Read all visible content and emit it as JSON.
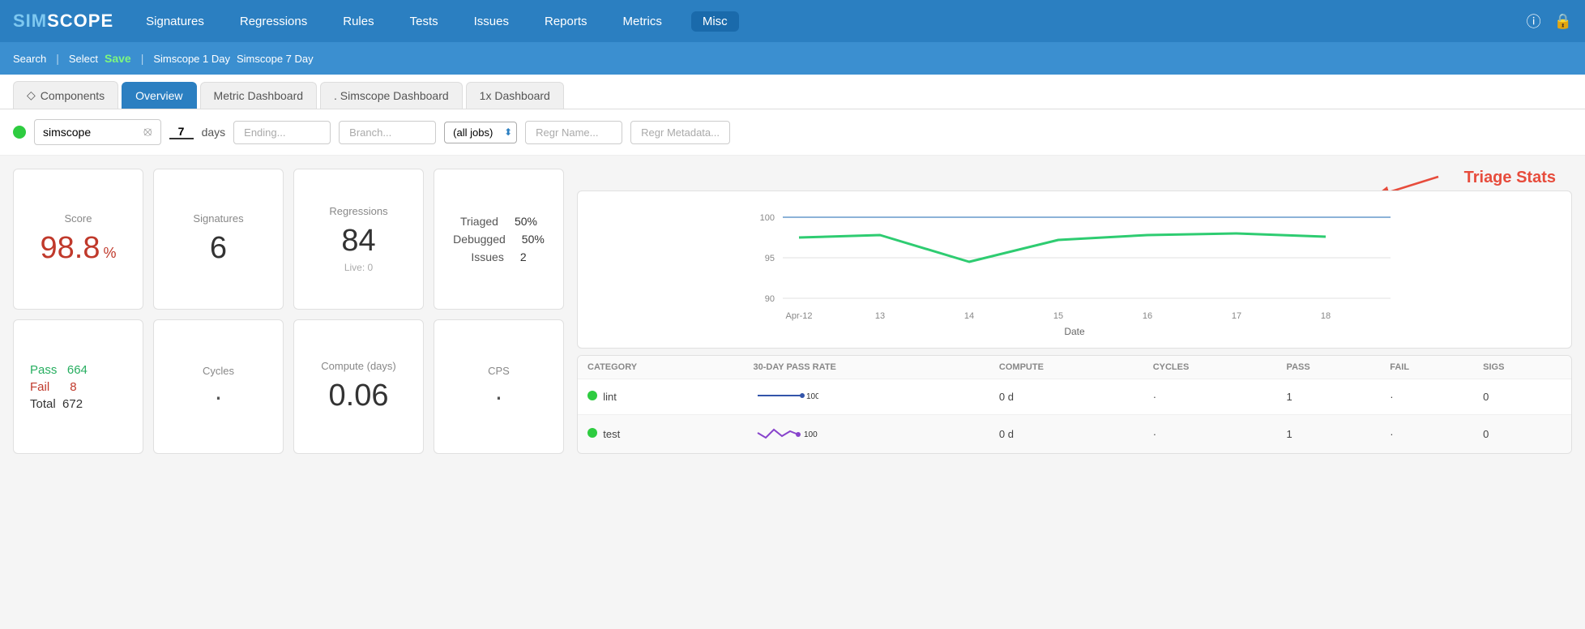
{
  "logo": {
    "text1": "SIM",
    "text2": "SCOPE"
  },
  "nav": {
    "items": [
      {
        "label": "Signatures",
        "active": false
      },
      {
        "label": "Regressions",
        "active": false
      },
      {
        "label": "Rules",
        "active": false
      },
      {
        "label": "Tests",
        "active": false
      },
      {
        "label": "Issues",
        "active": false
      },
      {
        "label": "Reports",
        "active": false
      },
      {
        "label": "Metrics",
        "active": false
      },
      {
        "label": "Misc",
        "active": true
      }
    ]
  },
  "sub_nav": {
    "search": "Search",
    "sep1": "|",
    "select": "Select",
    "save": "Save",
    "sep2": "|",
    "item1": "Simscope 1 Day",
    "item2": "Simscope 7 Day"
  },
  "tabs": [
    {
      "label": "Components",
      "active": false,
      "icon": true
    },
    {
      "label": "Overview",
      "active": true
    },
    {
      "label": "Metric Dashboard",
      "active": false
    },
    {
      "label": ". Simscope Dashboard",
      "active": false
    },
    {
      "label": "1x Dashboard",
      "active": false
    }
  ],
  "filters": {
    "project": "simscope",
    "days": "7",
    "days_label": "days",
    "ending_placeholder": "Ending...",
    "branch_placeholder": "Branch...",
    "jobs_option": "(all jobs)",
    "regr_name_placeholder": "Regr Name...",
    "regr_meta_placeholder": "Regr Metadata..."
  },
  "stats": {
    "score_label": "Score",
    "score_value": "98.8",
    "score_pct": "%",
    "signatures_label": "Signatures",
    "signatures_value": "6",
    "regressions_label": "Regressions",
    "regressions_value": "84",
    "regressions_sub": "Live: 0",
    "triage_label": "Triaged",
    "triage_value": "50%",
    "debugged_label": "Debugged",
    "debugged_value": "50%",
    "issues_label": "Issues",
    "issues_value": "2",
    "pass_label": "Pass",
    "pass_value": "664",
    "fail_label": "Fail",
    "fail_value": "8",
    "total_label": "Total",
    "total_value": "672",
    "cycles_label": "Cycles",
    "cycles_value": "·",
    "compute_label": "Compute (days)",
    "compute_value": "0.06",
    "cps_label": "CPS",
    "cps_value": "·"
  },
  "triage_annotation": "Triage Stats",
  "chart": {
    "y_labels": [
      "100",
      "95",
      "90"
    ],
    "x_labels": [
      "Apr-12",
      "13",
      "14",
      "15",
      "16",
      "17",
      "18"
    ],
    "x_axis_label": "Date"
  },
  "table": {
    "headers": [
      "CATEGORY",
      "30-DAY PASS RATE",
      "COMPUTE",
      "CYCLES",
      "PASS",
      "FAIL",
      "SIGS"
    ],
    "rows": [
      {
        "dot": true,
        "category": "lint",
        "compute": "0 d",
        "cycles": "·",
        "pass": "1",
        "fail": "·",
        "sigs": "0"
      },
      {
        "dot": true,
        "category": "test",
        "compute": "0 d",
        "cycles": "·",
        "pass": "1",
        "fail": "·",
        "sigs": "0"
      }
    ]
  }
}
